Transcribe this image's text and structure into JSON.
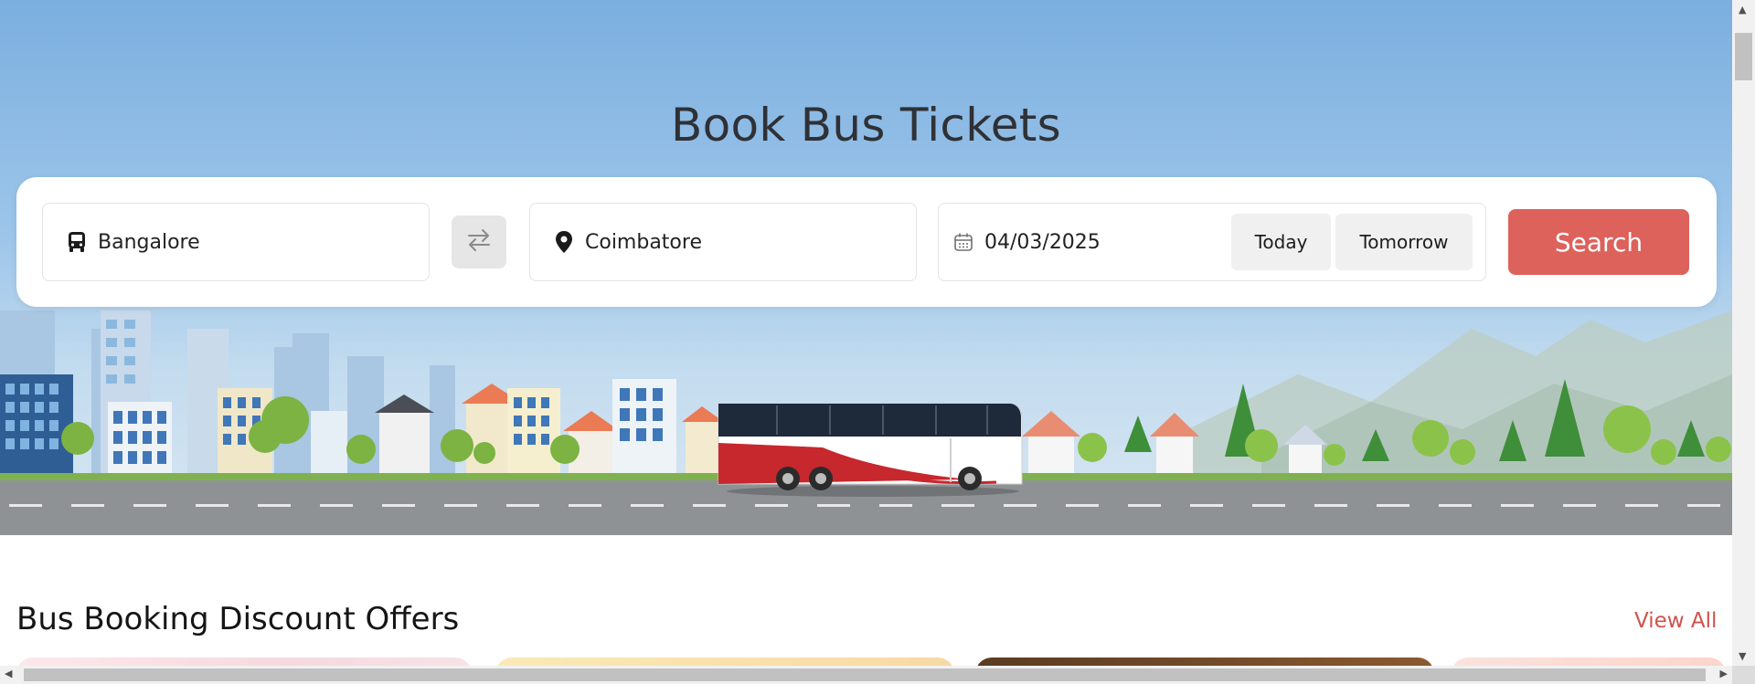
{
  "hero": {
    "title": "Book Bus Tickets"
  },
  "search": {
    "from_value": "Bangalore",
    "to_value": "Coimbatore",
    "date_value": "04/03/2025",
    "today_label": "Today",
    "tomorrow_label": "Tomorrow",
    "search_label": "Search",
    "icons": {
      "from": "bus-icon",
      "swap": "swap-icon",
      "to": "location-pin-icon",
      "date": "calendar-icon"
    }
  },
  "offers": {
    "title": "Bus Booking Discount Offers",
    "view_all_label": "View All"
  },
  "colors": {
    "primary_button": "#dd625c",
    "link": "#d0524c",
    "sky_top": "#7bafdf",
    "road": "#8f9295"
  }
}
